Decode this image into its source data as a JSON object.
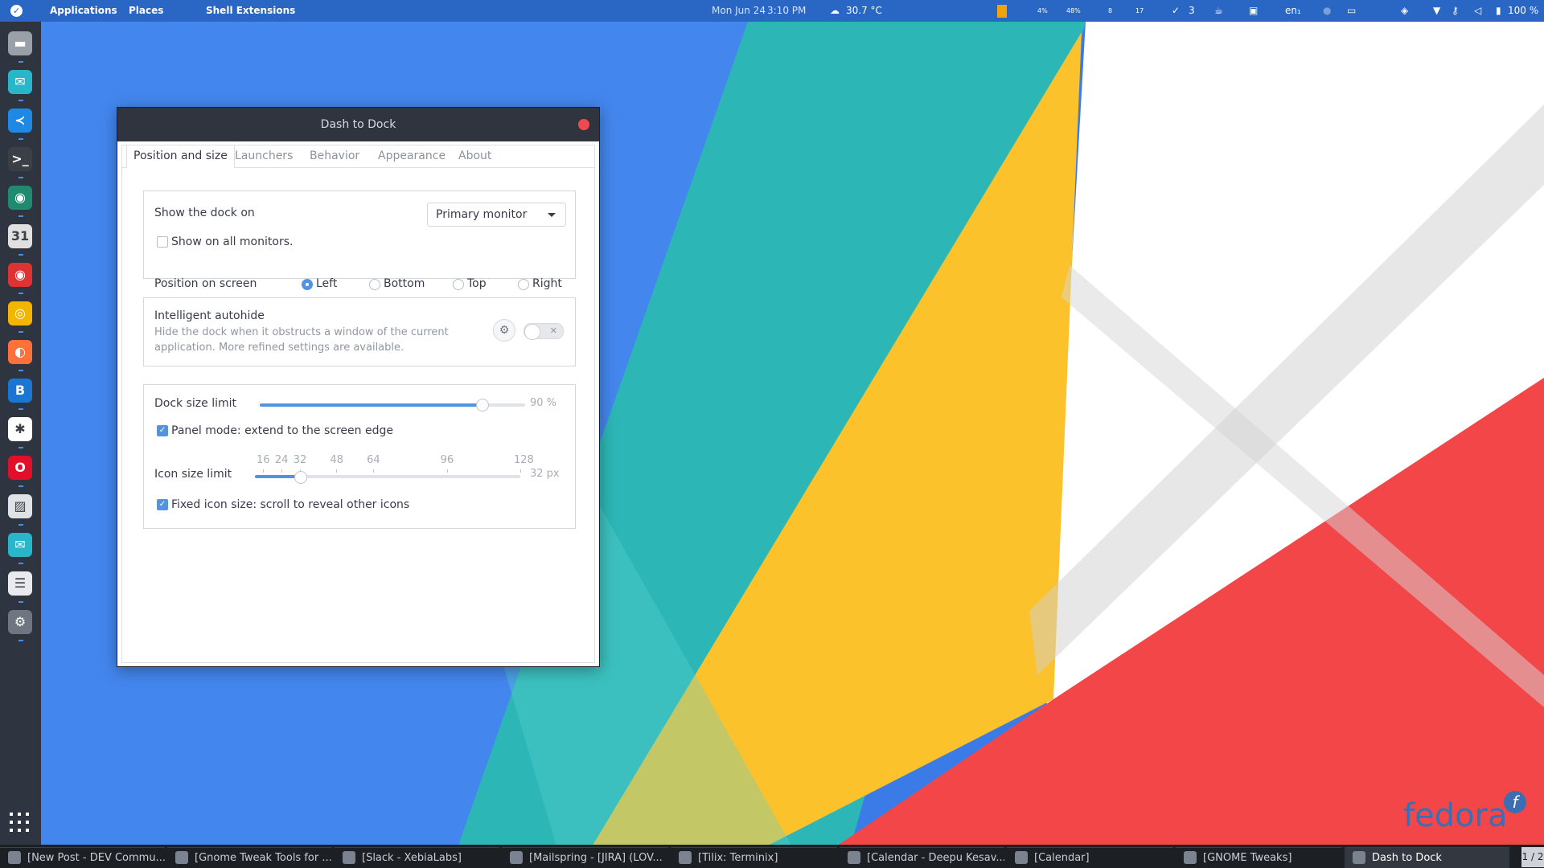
{
  "topbar": {
    "applications": "Applications",
    "places": "Places",
    "shell_extensions": "Shell Extensions",
    "date": "Mon Jun 24",
    "time": "3:10 PM",
    "weather": "30.7 °C",
    "cpu": "4%",
    "mem": "48%",
    "net_down": "8",
    "net_up": "17",
    "todo_count": "3",
    "keyboard": "en₁",
    "battery": "100 %"
  },
  "dock": {
    "apps": [
      {
        "name": "files",
        "icon": "folder-icon",
        "color": "#9aa0a8"
      },
      {
        "name": "mailspring",
        "icon": "mail-icon",
        "color": "#29b6c9"
      },
      {
        "name": "vscode",
        "icon": "vscode-icon",
        "color": "#1e88e5"
      },
      {
        "name": "terminal",
        "icon": "terminal-icon",
        "color": "#3b3f46"
      },
      {
        "name": "app-teal",
        "icon": "app-icon",
        "color": "#1f8a70"
      },
      {
        "name": "calendar",
        "icon": "calendar-icon",
        "color": "#e0e0e0"
      },
      {
        "name": "app-red",
        "icon": "app-icon",
        "color": "#d33"
      },
      {
        "name": "chrome",
        "icon": "chrome-icon",
        "color": "#f2b600"
      },
      {
        "name": "firefox",
        "icon": "firefox-icon",
        "color": "#ff7139"
      },
      {
        "name": "bitbucket",
        "icon": "b-icon",
        "color": "#1976d2"
      },
      {
        "name": "slack",
        "icon": "slack-icon",
        "color": "#ffffff"
      },
      {
        "name": "opera",
        "icon": "opera-icon",
        "color": "#e0102a"
      },
      {
        "name": "image-viewer",
        "icon": "image-icon",
        "color": "#dfe3e8"
      },
      {
        "name": "mail2",
        "icon": "mail-icon",
        "color": "#29b6c9"
      },
      {
        "name": "settings-panel",
        "icon": "panel-icon",
        "color": "#e8eaee"
      },
      {
        "name": "tweaks",
        "icon": "gear-icon",
        "color": "#6f7682"
      }
    ]
  },
  "window": {
    "title": "Dash to Dock",
    "tabs": [
      "Position and size",
      "Launchers",
      "Behavior",
      "Appearance",
      "About"
    ],
    "active_tab": "Position and size",
    "position": {
      "show_dock_on_label": "Show the dock on",
      "monitor_value": "Primary monitor",
      "show_all_monitors_label": "Show on all monitors.",
      "show_all_monitors": false,
      "position_label": "Position on screen",
      "options": [
        "Left",
        "Bottom",
        "Top",
        "Right"
      ],
      "selected": "Left"
    },
    "autohide": {
      "title": "Intelligent autohide",
      "description": "Hide the dock when it obstructs a window of the current application. More refined settings are available.",
      "enabled": false
    },
    "size": {
      "dock_size_label": "Dock size limit",
      "dock_size_value": "90 %",
      "dock_size_fraction": 0.9,
      "panel_mode_label": "Panel mode: extend to the screen edge",
      "panel_mode": true,
      "icon_size_label": "Icon size limit",
      "icon_marks": [
        "16",
        "24",
        "32",
        "48",
        "64",
        "96",
        "128"
      ],
      "icon_size_value": "32 px",
      "icon_size": 32,
      "fixed_icon_label": "Fixed icon size: scroll to reveal other icons",
      "fixed_icon": true
    }
  },
  "taskbar": {
    "tasks": [
      "[New Post - DEV Commu...",
      "[Gnome Tweak Tools for ...",
      "[Slack - XebiaLabs]",
      "[Mailspring - [JIRA] (LOV...",
      "[Tilix: Terminix]",
      "[Calendar - Deepu Kesav...",
      "[Calendar]",
      "[GNOME Tweaks]",
      "Dash to Dock"
    ],
    "workspace": "1 / 2"
  },
  "brand": "fedora"
}
